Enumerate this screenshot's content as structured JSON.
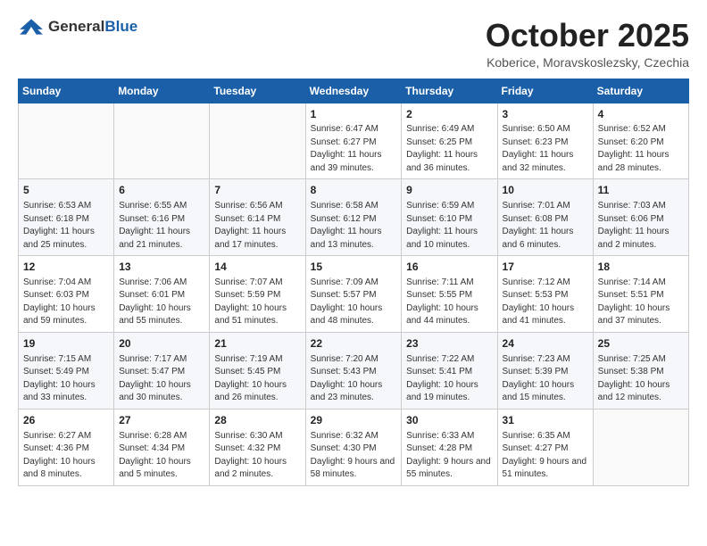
{
  "logo": {
    "general": "General",
    "blue": "Blue"
  },
  "title": "October 2025",
  "location": "Koberice, Moravskoslezsky, Czechia",
  "weekdays": [
    "Sunday",
    "Monday",
    "Tuesday",
    "Wednesday",
    "Thursday",
    "Friday",
    "Saturday"
  ],
  "weeks": [
    [
      {
        "day": "",
        "sunrise": "",
        "sunset": "",
        "daylight": ""
      },
      {
        "day": "",
        "sunrise": "",
        "sunset": "",
        "daylight": ""
      },
      {
        "day": "",
        "sunrise": "",
        "sunset": "",
        "daylight": ""
      },
      {
        "day": "1",
        "sunrise": "Sunrise: 6:47 AM",
        "sunset": "Sunset: 6:27 PM",
        "daylight": "Daylight: 11 hours and 39 minutes."
      },
      {
        "day": "2",
        "sunrise": "Sunrise: 6:49 AM",
        "sunset": "Sunset: 6:25 PM",
        "daylight": "Daylight: 11 hours and 36 minutes."
      },
      {
        "day": "3",
        "sunrise": "Sunrise: 6:50 AM",
        "sunset": "Sunset: 6:23 PM",
        "daylight": "Daylight: 11 hours and 32 minutes."
      },
      {
        "day": "4",
        "sunrise": "Sunrise: 6:52 AM",
        "sunset": "Sunset: 6:20 PM",
        "daylight": "Daylight: 11 hours and 28 minutes."
      }
    ],
    [
      {
        "day": "5",
        "sunrise": "Sunrise: 6:53 AM",
        "sunset": "Sunset: 6:18 PM",
        "daylight": "Daylight: 11 hours and 25 minutes."
      },
      {
        "day": "6",
        "sunrise": "Sunrise: 6:55 AM",
        "sunset": "Sunset: 6:16 PM",
        "daylight": "Daylight: 11 hours and 21 minutes."
      },
      {
        "day": "7",
        "sunrise": "Sunrise: 6:56 AM",
        "sunset": "Sunset: 6:14 PM",
        "daylight": "Daylight: 11 hours and 17 minutes."
      },
      {
        "day": "8",
        "sunrise": "Sunrise: 6:58 AM",
        "sunset": "Sunset: 6:12 PM",
        "daylight": "Daylight: 11 hours and 13 minutes."
      },
      {
        "day": "9",
        "sunrise": "Sunrise: 6:59 AM",
        "sunset": "Sunset: 6:10 PM",
        "daylight": "Daylight: 11 hours and 10 minutes."
      },
      {
        "day": "10",
        "sunrise": "Sunrise: 7:01 AM",
        "sunset": "Sunset: 6:08 PM",
        "daylight": "Daylight: 11 hours and 6 minutes."
      },
      {
        "day": "11",
        "sunrise": "Sunrise: 7:03 AM",
        "sunset": "Sunset: 6:06 PM",
        "daylight": "Daylight: 11 hours and 2 minutes."
      }
    ],
    [
      {
        "day": "12",
        "sunrise": "Sunrise: 7:04 AM",
        "sunset": "Sunset: 6:03 PM",
        "daylight": "Daylight: 10 hours and 59 minutes."
      },
      {
        "day": "13",
        "sunrise": "Sunrise: 7:06 AM",
        "sunset": "Sunset: 6:01 PM",
        "daylight": "Daylight: 10 hours and 55 minutes."
      },
      {
        "day": "14",
        "sunrise": "Sunrise: 7:07 AM",
        "sunset": "Sunset: 5:59 PM",
        "daylight": "Daylight: 10 hours and 51 minutes."
      },
      {
        "day": "15",
        "sunrise": "Sunrise: 7:09 AM",
        "sunset": "Sunset: 5:57 PM",
        "daylight": "Daylight: 10 hours and 48 minutes."
      },
      {
        "day": "16",
        "sunrise": "Sunrise: 7:11 AM",
        "sunset": "Sunset: 5:55 PM",
        "daylight": "Daylight: 10 hours and 44 minutes."
      },
      {
        "day": "17",
        "sunrise": "Sunrise: 7:12 AM",
        "sunset": "Sunset: 5:53 PM",
        "daylight": "Daylight: 10 hours and 41 minutes."
      },
      {
        "day": "18",
        "sunrise": "Sunrise: 7:14 AM",
        "sunset": "Sunset: 5:51 PM",
        "daylight": "Daylight: 10 hours and 37 minutes."
      }
    ],
    [
      {
        "day": "19",
        "sunrise": "Sunrise: 7:15 AM",
        "sunset": "Sunset: 5:49 PM",
        "daylight": "Daylight: 10 hours and 33 minutes."
      },
      {
        "day": "20",
        "sunrise": "Sunrise: 7:17 AM",
        "sunset": "Sunset: 5:47 PM",
        "daylight": "Daylight: 10 hours and 30 minutes."
      },
      {
        "day": "21",
        "sunrise": "Sunrise: 7:19 AM",
        "sunset": "Sunset: 5:45 PM",
        "daylight": "Daylight: 10 hours and 26 minutes."
      },
      {
        "day": "22",
        "sunrise": "Sunrise: 7:20 AM",
        "sunset": "Sunset: 5:43 PM",
        "daylight": "Daylight: 10 hours and 23 minutes."
      },
      {
        "day": "23",
        "sunrise": "Sunrise: 7:22 AM",
        "sunset": "Sunset: 5:41 PM",
        "daylight": "Daylight: 10 hours and 19 minutes."
      },
      {
        "day": "24",
        "sunrise": "Sunrise: 7:23 AM",
        "sunset": "Sunset: 5:39 PM",
        "daylight": "Daylight: 10 hours and 15 minutes."
      },
      {
        "day": "25",
        "sunrise": "Sunrise: 7:25 AM",
        "sunset": "Sunset: 5:38 PM",
        "daylight": "Daylight: 10 hours and 12 minutes."
      }
    ],
    [
      {
        "day": "26",
        "sunrise": "Sunrise: 6:27 AM",
        "sunset": "Sunset: 4:36 PM",
        "daylight": "Daylight: 10 hours and 8 minutes."
      },
      {
        "day": "27",
        "sunrise": "Sunrise: 6:28 AM",
        "sunset": "Sunset: 4:34 PM",
        "daylight": "Daylight: 10 hours and 5 minutes."
      },
      {
        "day": "28",
        "sunrise": "Sunrise: 6:30 AM",
        "sunset": "Sunset: 4:32 PM",
        "daylight": "Daylight: 10 hours and 2 minutes."
      },
      {
        "day": "29",
        "sunrise": "Sunrise: 6:32 AM",
        "sunset": "Sunset: 4:30 PM",
        "daylight": "Daylight: 9 hours and 58 minutes."
      },
      {
        "day": "30",
        "sunrise": "Sunrise: 6:33 AM",
        "sunset": "Sunset: 4:28 PM",
        "daylight": "Daylight: 9 hours and 55 minutes."
      },
      {
        "day": "31",
        "sunrise": "Sunrise: 6:35 AM",
        "sunset": "Sunset: 4:27 PM",
        "daylight": "Daylight: 9 hours and 51 minutes."
      },
      {
        "day": "",
        "sunrise": "",
        "sunset": "",
        "daylight": ""
      }
    ]
  ]
}
